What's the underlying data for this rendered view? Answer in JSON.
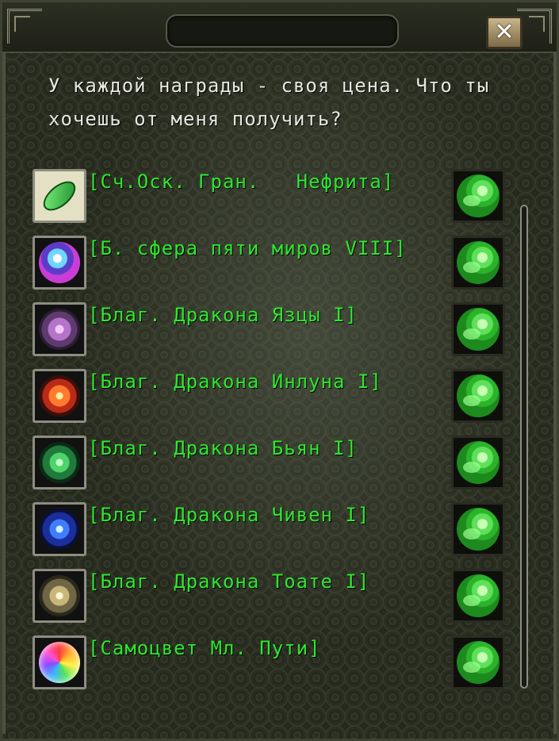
{
  "dialog": {
    "prompt_line1": "У каждой награды - своя цена. Что ты",
    "prompt_line2": "хочешь от меня получить?",
    "close_label": "✕"
  },
  "colors": {
    "item_text": "#2ee82e",
    "prompt_text": "#e8e8e0"
  },
  "rewards": [
    {
      "name": "[Сч.Оск. Гран.   Нефрита]",
      "icon": "jade-leaf-icon"
    },
    {
      "name": "[Б. сфера пяти миров VIII]",
      "icon": "five-worlds-sphere-icon"
    },
    {
      "name": "[Благ. Дракона Язцы I]",
      "icon": "dragon-pearl-violet-icon"
    },
    {
      "name": "[Благ. Дракона Инлуна I]",
      "icon": "dragon-pearl-red-icon"
    },
    {
      "name": "[Благ. Дракона Бьян I]",
      "icon": "dragon-pearl-green-icon"
    },
    {
      "name": "[Благ. Дракона Чивен I]",
      "icon": "dragon-pearl-blue-icon"
    },
    {
      "name": "[Благ. Дракона Тоате I]",
      "icon": "dragon-pearl-gold-icon"
    },
    {
      "name": "[Самоцвет Мл. Пути]",
      "icon": "rainbow-gem-icon"
    }
  ]
}
